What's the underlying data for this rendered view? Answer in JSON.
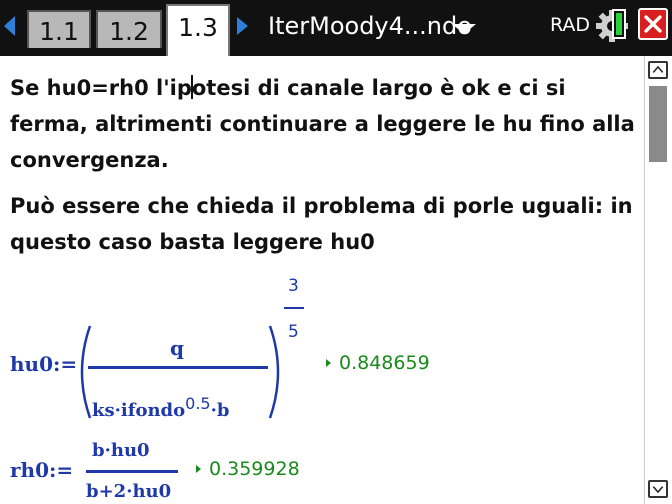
{
  "tabs": [
    {
      "label": "1.1"
    },
    {
      "label": "1.2"
    },
    {
      "label": "1.3"
    }
  ],
  "document": {
    "title": "IterMoody4...ndo"
  },
  "status": {
    "angle_mode": "RAD"
  },
  "text": {
    "para1_before_cursor": "Se hu0=rh0 l'ip",
    "para1_after_cursor": "otesi di canale largo è ok e ci si ferma, altrimenti continuare a leggere le hu fino alla convergenza.",
    "para2": "Può essere che chieda il problema di porle uguali: in questo caso basta leggere hu0"
  },
  "math": {
    "hu0": {
      "lhs": "hu0:=",
      "numerator": "q",
      "denominator_main": "ks·ifondo",
      "denominator_exp": "0.5",
      "denominator_tail": "·b",
      "exponent_num": "3",
      "exponent_den": "5",
      "result": "0.848659"
    },
    "rh0": {
      "lhs": "rh0:=",
      "numerator": "b·hu0",
      "denominator": "b+2·hu0",
      "result": "0.359928"
    }
  },
  "icons": {
    "nav_left": "left-arrow-icon",
    "nav_right": "right-arrow-icon",
    "doc_menu": "chevron-down-icon",
    "gear": "gear-icon",
    "battery": "battery-icon",
    "close": "close-icon",
    "scroll_up": "scroll-up-icon",
    "scroll_down": "scroll-down-icon"
  },
  "colors": {
    "topbar": "#111111",
    "nav_arrow": "#2f7fd8",
    "math": "#1f3aa8",
    "result": "#1a8a1a",
    "close": "#d9201f",
    "battery": "#2bd13a"
  }
}
